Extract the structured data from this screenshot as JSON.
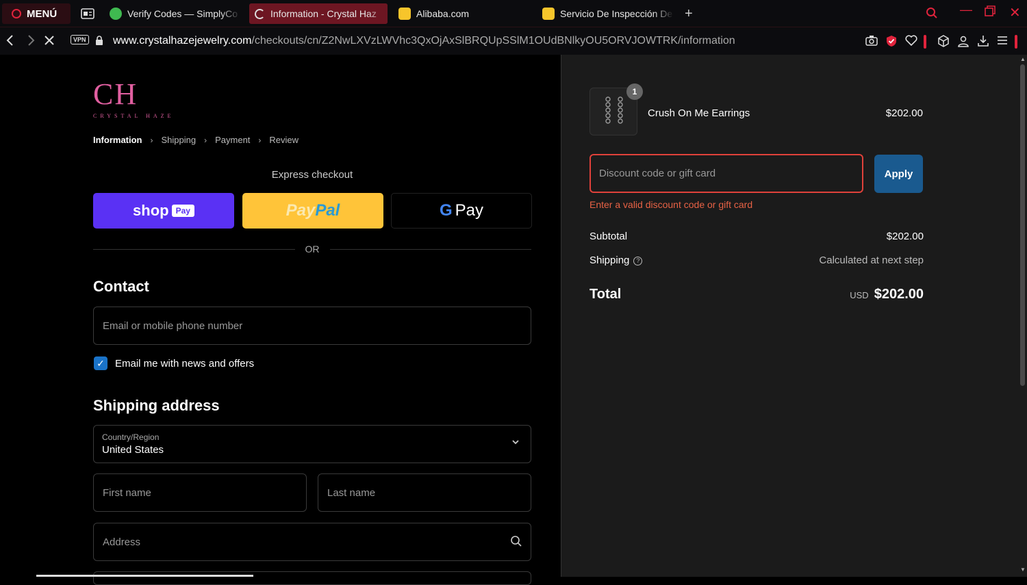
{
  "browser": {
    "menu_label": "MENÚ",
    "tabs": [
      {
        "label": "Verify Codes — SimplyCo"
      },
      {
        "label": "Information - Crystal Haz"
      },
      {
        "label": "Alibaba.com"
      },
      {
        "label": "Servicio De Inspección De"
      }
    ],
    "vpn_label": "VPN",
    "url_domain": "www.crystalhazejewelry.com",
    "url_path": "/checkouts/cn/Z2NwLXVzLWVhc3QxOjAxSlBRQUpSSlM1OUdBNlkyOU5ORVJOWTRK/information"
  },
  "store": {
    "logo_mark": "CH",
    "logo_text": "CRYSTAL HAZE"
  },
  "breadcrumb": [
    "Information",
    "Shipping",
    "Payment",
    "Review"
  ],
  "express": {
    "label": "Express checkout",
    "shop_label": "shop",
    "shop_pay_label": "Pay",
    "paypal_label_1": "Pay",
    "paypal_label_2": "Pal",
    "gpay_g": "G",
    "gpay_label": "Pay",
    "or_label": "OR"
  },
  "contact": {
    "heading": "Contact",
    "email_placeholder": "Email or mobile phone number",
    "news_label": "Email me with news and offers",
    "news_checked": true
  },
  "shipping": {
    "heading": "Shipping address",
    "country_label": "Country/Region",
    "country_value": "United States",
    "first_name_placeholder": "First name",
    "last_name_placeholder": "Last name",
    "address_placeholder": "Address"
  },
  "order": {
    "item_qty": "1",
    "item_name": "Crush On Me Earrings",
    "item_price": "$202.00",
    "discount_placeholder": "Discount code or gift card",
    "apply_label": "Apply",
    "discount_error": "Enter a valid discount code or gift card",
    "subtotal_label": "Subtotal",
    "subtotal_value": "$202.00",
    "shipping_label": "Shipping",
    "shipping_value": "Calculated at next step",
    "total_label": "Total",
    "total_currency": "USD",
    "total_value": "$202.00"
  },
  "colors": {
    "accent_red": "#e0233c",
    "shop_pay": "#5a31f4",
    "paypal": "#ffc439",
    "apply": "#1a5a8f",
    "error": "#e86245",
    "logo": "#e05fa0"
  }
}
